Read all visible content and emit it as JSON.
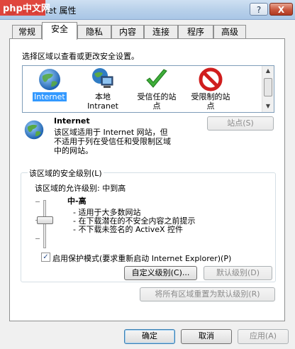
{
  "window": {
    "title": "Internet 属性",
    "logo_text": "php中文网",
    "help_label": "?",
    "close_label": "X"
  },
  "tabs": [
    "常规",
    "安全",
    "隐私",
    "内容",
    "连接",
    "程序",
    "高级"
  ],
  "active_tab": "安全",
  "security": {
    "select_prompt": "选择区域以查看或更改安全设置。",
    "zones": [
      {
        "label": "Internet",
        "icon": "globe-icon",
        "selected": true
      },
      {
        "label": "本地\nIntranet",
        "icon": "intranet-icon",
        "selected": false
      },
      {
        "label": "受信任的站\n点",
        "icon": "checkmark-icon",
        "selected": false
      },
      {
        "label": "受限制的站\n点",
        "icon": "prohibited-icon",
        "selected": false
      }
    ],
    "zone_title": "Internet",
    "zone_desc": "该区域适用于 Internet 网站，但\n不适用于列在受信任和受限制区域\n中的网站。",
    "sites_button": "站点(S)",
    "level_group_title": "该区域的安全级别(L)",
    "allowed_levels": "该区域的允许级别: 中到高",
    "level_name": "中-高",
    "level_bullets": [
      "- 适用于大多数网站",
      "- 在下载潜在的不安全内容之前提示",
      "- 不下载未签名的 ActiveX 控件"
    ],
    "protected_mode_checked": true,
    "protected_mode_label": "启用保护模式(要求重新启动 Internet Explorer)(P)",
    "custom_level_button": "自定义级别(C)...",
    "default_level_button": "默认级别(D)",
    "reset_all_button": "将所有区域重置为默认级别(R)"
  },
  "footer": {
    "ok": "确定",
    "cancel": "取消",
    "apply": "应用(A)"
  },
  "colors": {
    "selection": "#3399ff",
    "titlebar": "#b9d1ea",
    "panel": "#ffffff"
  }
}
